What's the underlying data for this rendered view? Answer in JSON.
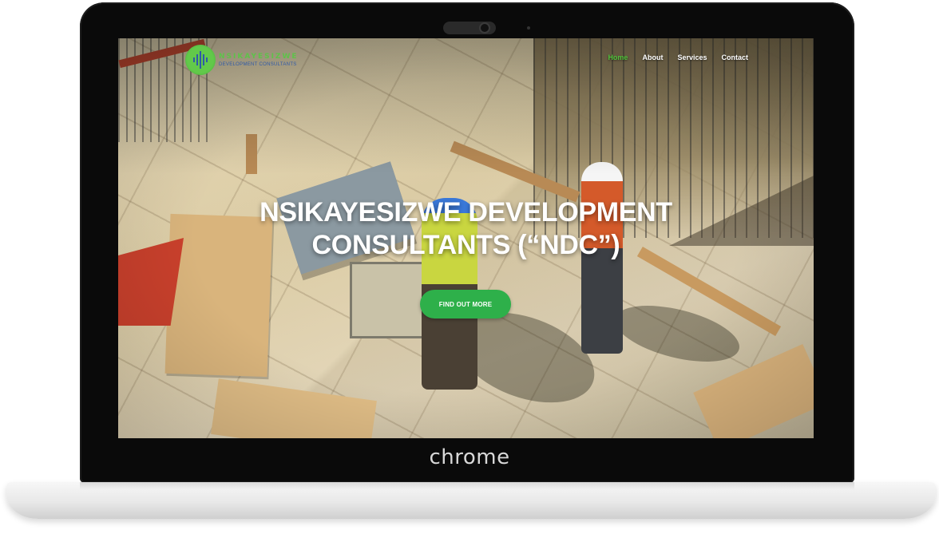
{
  "device": {
    "brand_wordmark": "chrome"
  },
  "site": {
    "logo": {
      "name": "NSIKAYESIZWE",
      "subtitle": "DEVELOPMENT CONSULTANTS"
    },
    "nav": {
      "items": [
        {
          "label": "Home",
          "active": true
        },
        {
          "label": "About",
          "active": false
        },
        {
          "label": "Services",
          "active": false
        },
        {
          "label": "Contact",
          "active": false
        }
      ]
    },
    "hero": {
      "title_line1": "NSIKAYESIZWE DEVELOPMENT",
      "title_line2": "CONSULTANTS (“NDC”)",
      "cta_label": "FIND OUT MORE"
    }
  },
  "colors": {
    "accent": "#2eb04a",
    "nav_active": "#4fc13a",
    "logo_blue": "#2f5aa8"
  }
}
